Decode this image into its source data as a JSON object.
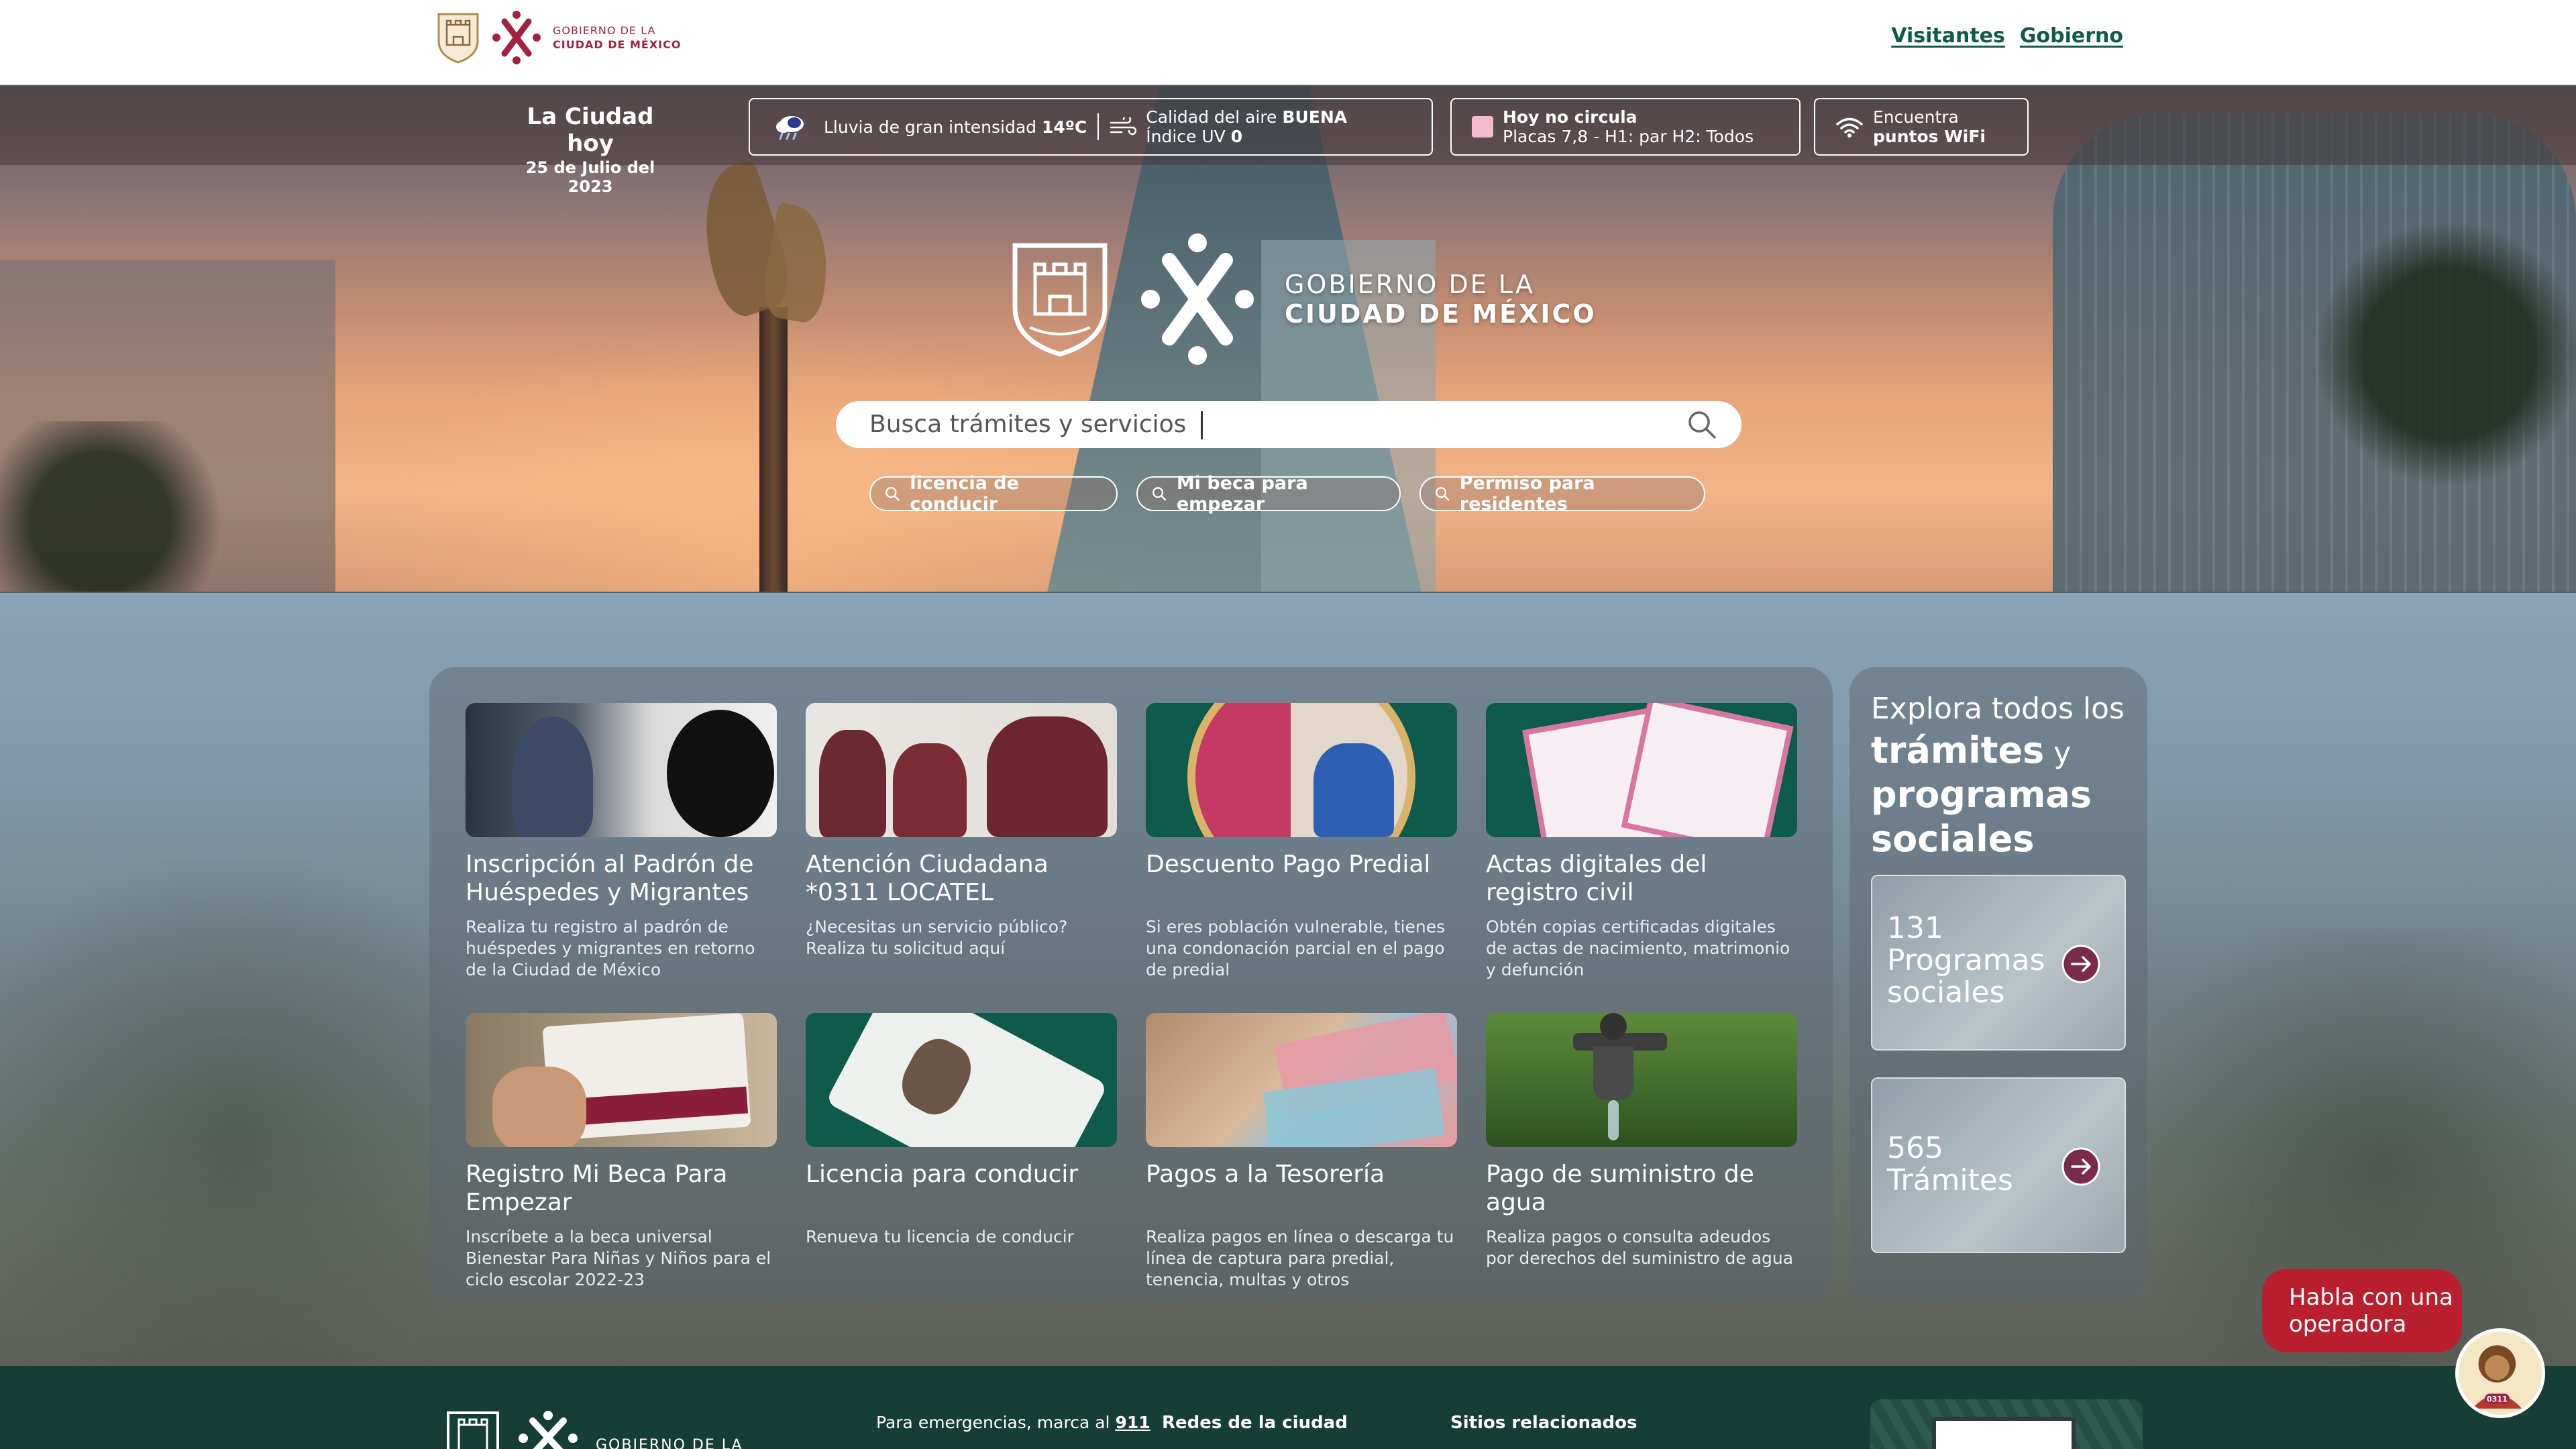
{
  "header": {
    "gov_line1": "GOBIERNO DE LA",
    "gov_line2": "CIUDAD DE MÉXICO",
    "links": [
      "Visitantes",
      "Gobierno"
    ]
  },
  "info_bar": {
    "city_title": "La Ciudad hoy",
    "date": "25 de Julio del 2023",
    "weather_text": "Lluvia de gran intensidad",
    "temperature": "14ºC",
    "air_label": "Calidad del aire",
    "air_value": "BUENA",
    "uv_label": "Índice UV",
    "uv_value": "0",
    "no_circula_title": "Hoy no circula",
    "no_circula_detail": "Placas 7,8 - H1: par H2: Todos",
    "wifi_line1": "Encuentra",
    "wifi_line2": "puntos WiFi",
    "no_circula_color": "#f3b9cc"
  },
  "hero": {
    "gov_line1": "GOBIERNO DE LA",
    "gov_line2": "CIUDAD DE MÉXICO",
    "search_placeholder": "Busca trámites y servicios",
    "chips": [
      "licencia de conducir",
      "Mi beca para empezar",
      "Permiso para residentes"
    ]
  },
  "cards": [
    {
      "title": "Inscripción al Padrón de Huéspedes y Migrantes",
      "desc": "Realiza tu registro al padrón de huéspedes y migrantes en retorno de la Ciudad de México"
    },
    {
      "title": "Atención Ciudadana *0311 LOCATEL",
      "desc": "¿Necesitas un servicio público? Realiza tu solicitud aquí"
    },
    {
      "title": "Descuento Pago Predial",
      "desc": "Si eres población vulnerable, tienes una condonación parcial en el pago de predial"
    },
    {
      "title": "Actas digitales del registro civil",
      "desc": "Obtén copias certificadas digitales de actas de nacimiento, matrimonio y defunción"
    },
    {
      "title": "Registro Mi Beca Para Empezar",
      "desc": "Inscríbete a la beca universal Bienestar Para Niñas y Niños para el ciclo escolar 2022-23"
    },
    {
      "title": "Licencia para conducir",
      "desc": "Renueva tu licencia de conducir"
    },
    {
      "title": "Pagos a la Tesorería",
      "desc": "Realiza pagos en línea o descarga tu línea de captura para predial, tenencia, multas y otros"
    },
    {
      "title": "Pago de suministro de agua",
      "desc": "Realiza pagos o consulta adeudos por derechos del suministro de agua"
    }
  ],
  "explore": {
    "line1": "Explora todos los",
    "strong1": "trámites",
    "mid": " y",
    "strong2": "programas sociales",
    "programs_count": "131",
    "programs_label": "Programas sociales",
    "tramites_count": "565",
    "tramites_label": "Trámites"
  },
  "chat": {
    "bubble": "Habla con una operadora",
    "badge": "0311"
  },
  "footer": {
    "gov_line1": "GOBIERNO DE LA",
    "emergency_text": "Para emergencias, marca al",
    "emergency_number": "911",
    "redes": "Redes de la ciudad",
    "sitios": "Sitios relacionados"
  },
  "colors": {
    "brand_red": "#9f2241",
    "brand_green": "#0f5b4b",
    "footer_bg": "#173e36",
    "chat_red": "#b91f2e"
  }
}
